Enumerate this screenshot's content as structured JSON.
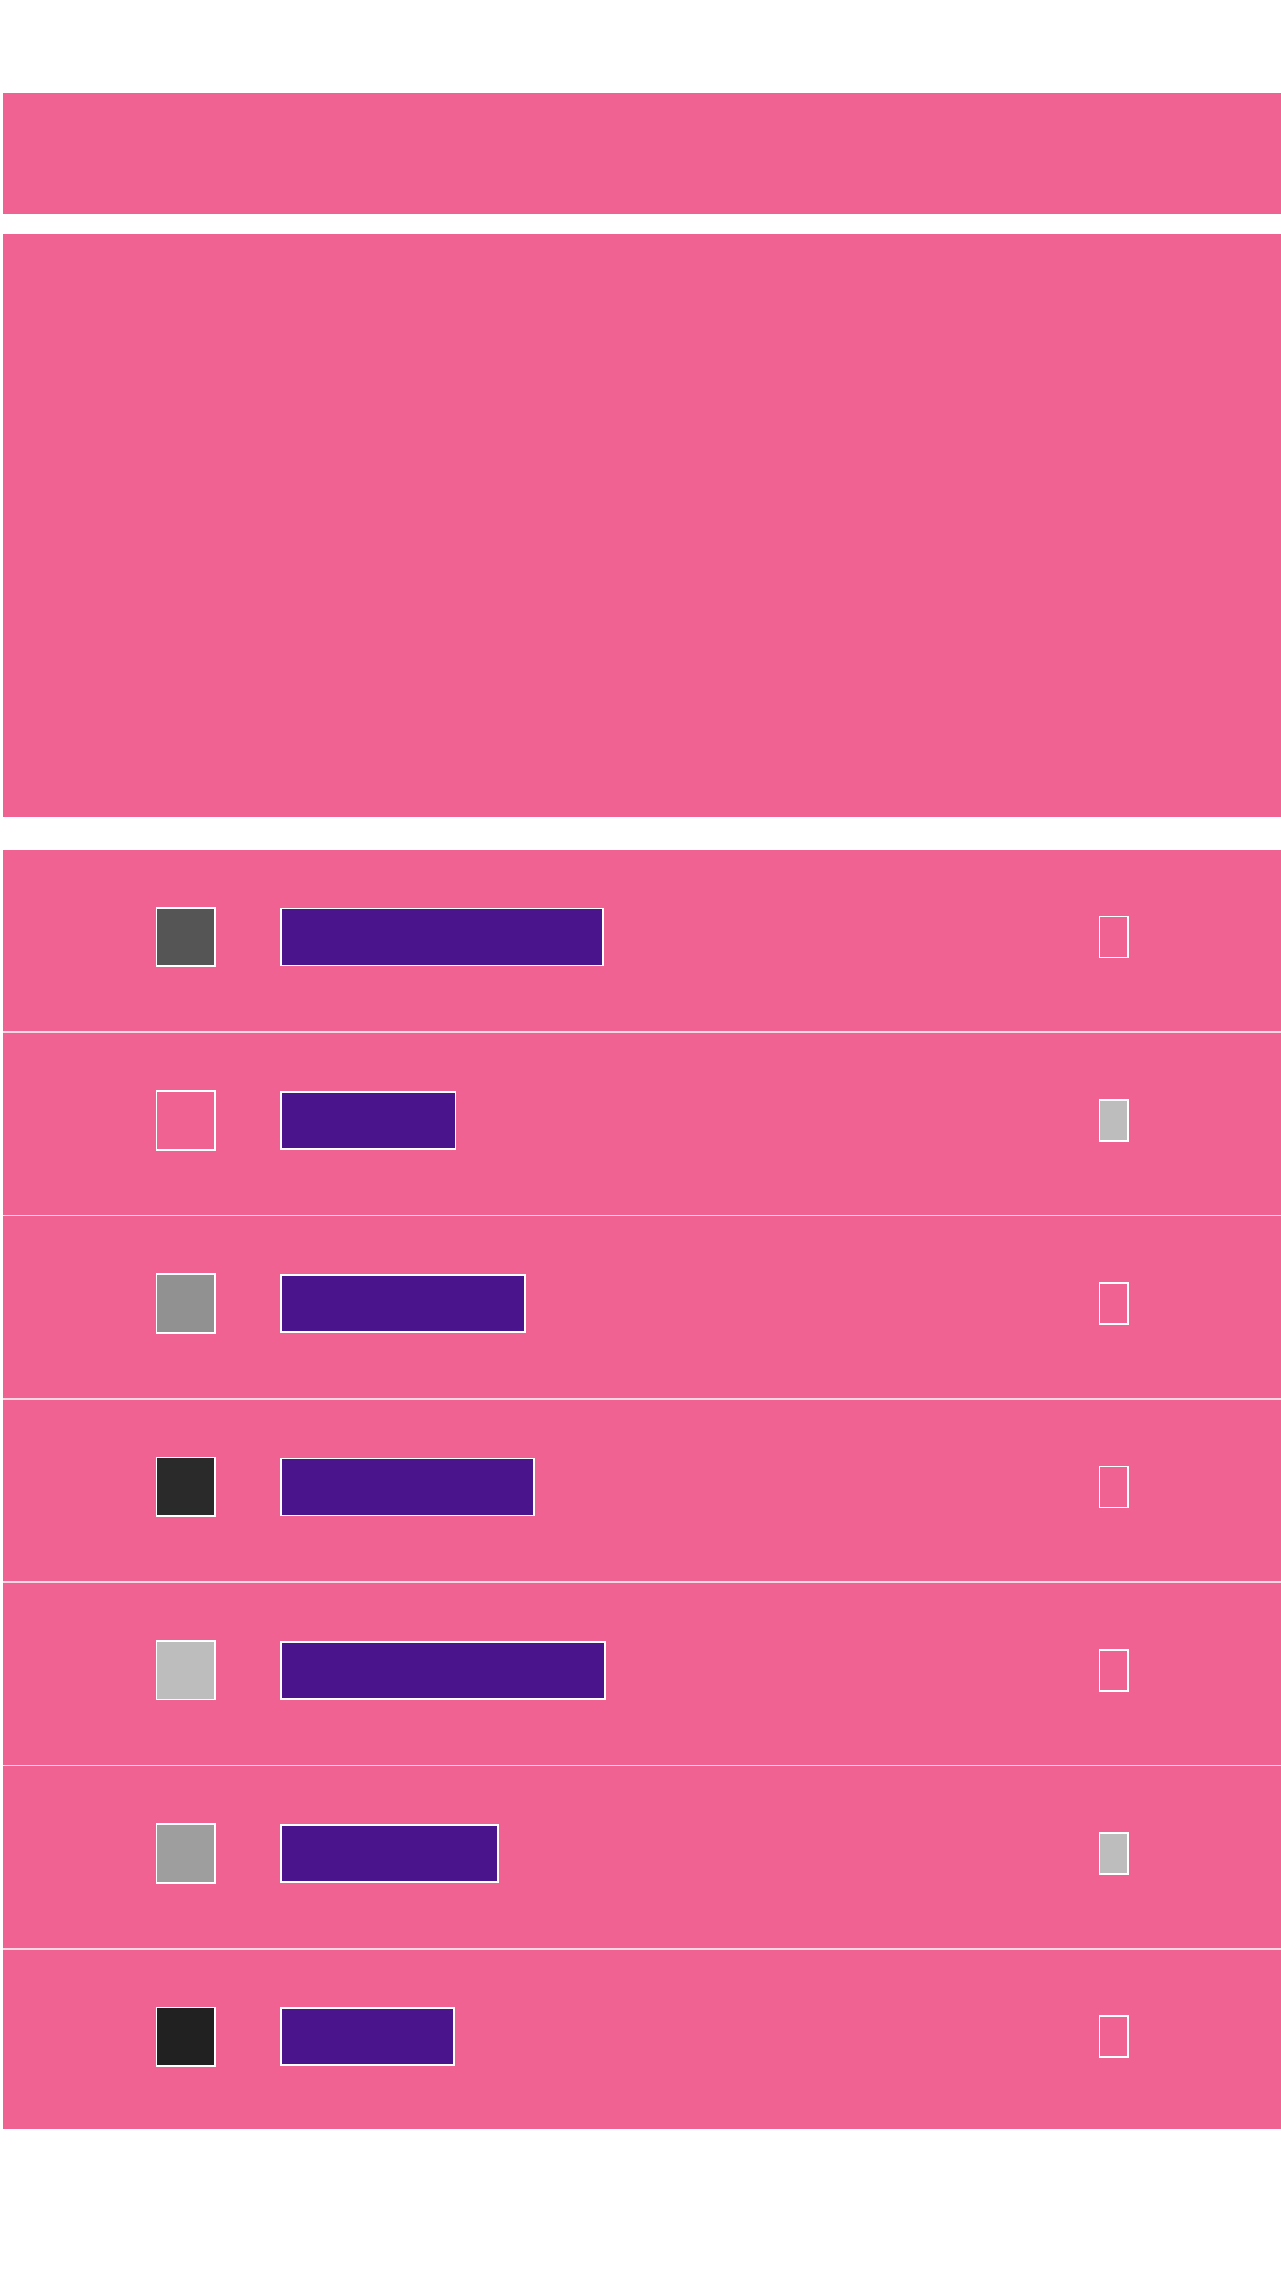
{
  "app_bar": {
    "color": "#f06292"
  },
  "hero": {
    "color": "#f06292"
  },
  "list": {
    "background": "#f06292",
    "label_color": "#4a148c",
    "checked_color": "#bdbdbd",
    "items": [
      {
        "swatch_color": "#555555",
        "label": "",
        "checked": false
      },
      {
        "swatch_color": "#f06292",
        "label": "",
        "checked": true
      },
      {
        "swatch_color": "#919191",
        "label": "",
        "checked": false
      },
      {
        "swatch_color": "#2a2a2a",
        "label": "",
        "checked": false
      },
      {
        "swatch_color": "#bdbdbd",
        "label": "",
        "checked": false
      },
      {
        "swatch_color": "#9e9e9e",
        "label": "",
        "checked": true
      },
      {
        "swatch_color": "#212121",
        "label": "",
        "checked": false
      }
    ]
  }
}
